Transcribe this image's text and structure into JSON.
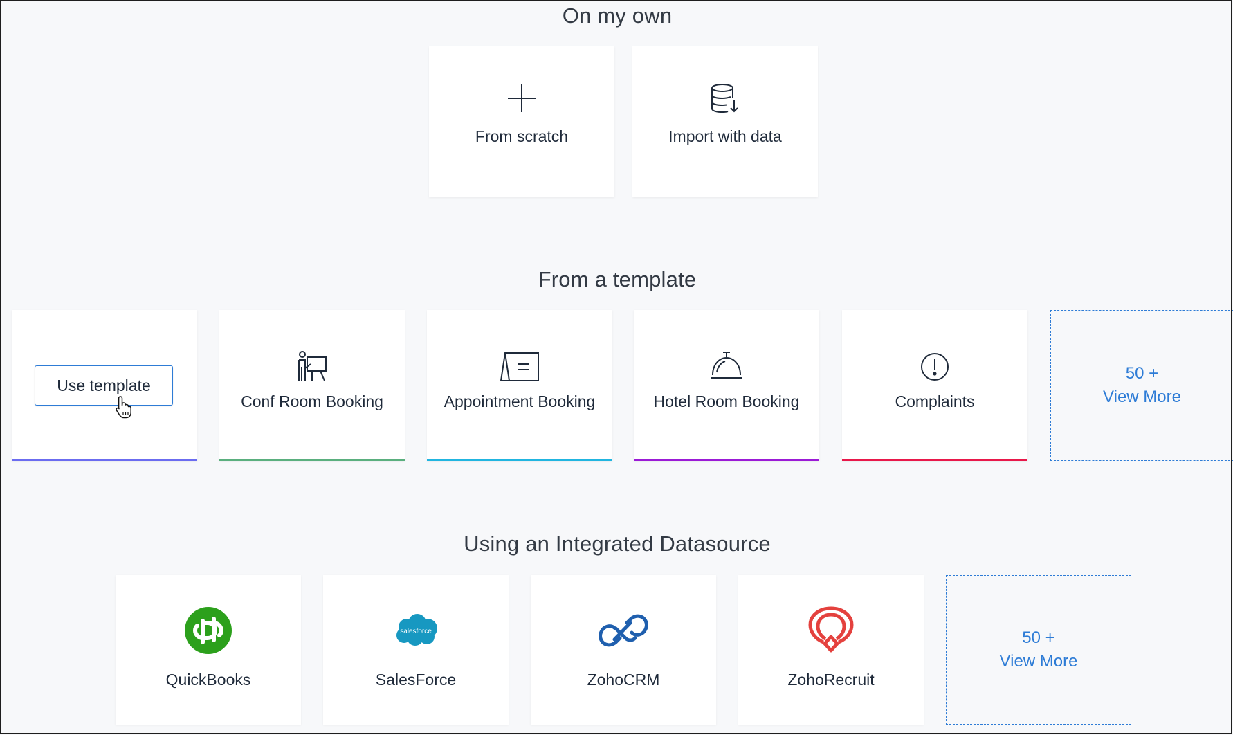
{
  "sections": {
    "own": {
      "title": "On my own"
    },
    "template": {
      "title": "From a template"
    },
    "datasource": {
      "title": "Using an Integrated Datasource"
    }
  },
  "own_cards": [
    {
      "label": "From scratch",
      "icon": "plus-icon"
    },
    {
      "label": "Import with data",
      "icon": "database-import-icon"
    }
  ],
  "template_cards": [
    {
      "label": "",
      "button_label": "Use template",
      "accent": "#6b6cf0"
    },
    {
      "label": "Conf Room Booking",
      "icon": "presenter-board-icon",
      "accent": "#5aaf7e"
    },
    {
      "label": "Appointment Booking",
      "icon": "desk-calendar-icon",
      "accent": "#21b5e0"
    },
    {
      "label": "Hotel Room Booking",
      "icon": "service-bell-icon",
      "accent": "#9b1bd6"
    },
    {
      "label": "Complaints",
      "icon": "exclamation-circle-icon",
      "accent": "#e8184a"
    }
  ],
  "template_more": {
    "count": "50 +",
    "label": "View More"
  },
  "datasource_cards": [
    {
      "label": "QuickBooks",
      "icon": "quickbooks-logo",
      "color": "#2ca01c"
    },
    {
      "label": "SalesForce",
      "icon": "salesforce-logo",
      "logo_text": "salesforce",
      "color": "#1798c1"
    },
    {
      "label": "ZohoCRM",
      "icon": "zohocrm-logo",
      "color": "#1f5fae"
    },
    {
      "label": "ZohoRecruit",
      "icon": "zohorecruit-logo",
      "color": "#e4413e"
    }
  ],
  "datasource_more": {
    "count": "50 +",
    "label": "View More"
  },
  "colors": {
    "link": "#2e7cd6",
    "background": "#f7f8fa",
    "card": "#ffffff"
  }
}
